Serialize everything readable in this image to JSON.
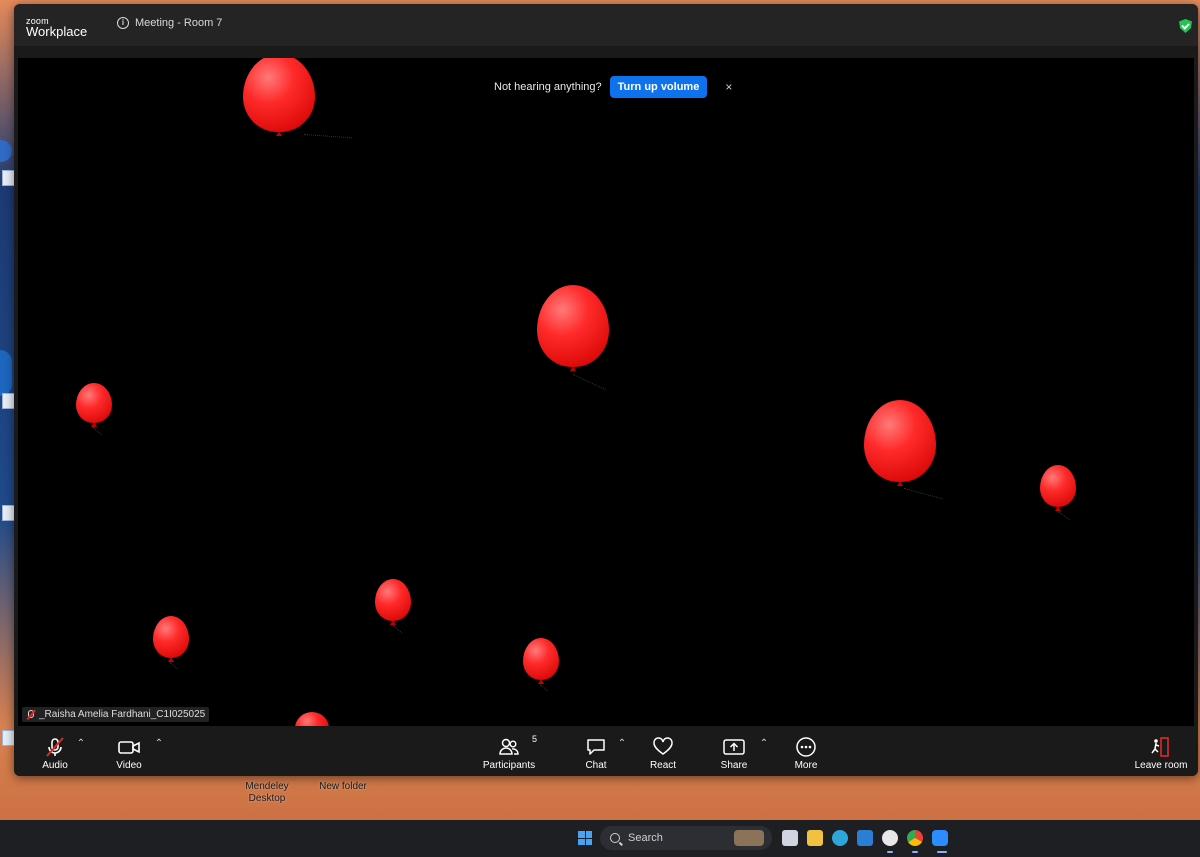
{
  "window": {
    "brand_small": "zoom",
    "brand_big": "Workplace",
    "meeting_title": "Meeting - Room 7"
  },
  "notice": {
    "text": "Not hearing anything?",
    "button": "Turn up volume",
    "close": "×"
  },
  "participant": {
    "name": "_Raisha Amelia Fardhani_C1I025025"
  },
  "toolbar": {
    "audio": "Audio",
    "video": "Video",
    "participants": "Participants",
    "participants_count": "5",
    "chat": "Chat",
    "react": "React",
    "share": "Share",
    "more": "More",
    "leave": "Leave room"
  },
  "desktop": {
    "icon1": "Mendeley Desktop",
    "icon2": "New folder"
  },
  "taskbar": {
    "search": "Search"
  },
  "colors": {
    "accent": "#0e72ed",
    "balloon": "#ff1f1f",
    "secure": "#23c552",
    "leave": "#e02828"
  }
}
